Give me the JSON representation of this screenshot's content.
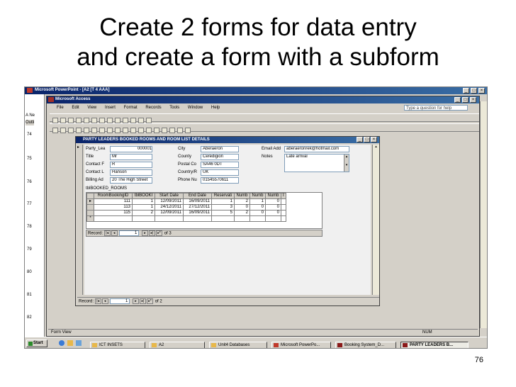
{
  "slide": {
    "title_line1": "Create 2 forms for data entry",
    "title_line2": "and create a form with a subform",
    "page_number": "76"
  },
  "powerpoint": {
    "title": "Microsoft PowerPoint - [A2 [T 4 AAA]",
    "side_tabs": [
      "A Ne",
      "Outli"
    ],
    "slide_numbers": [
      "74",
      "75",
      "76",
      "77",
      "78",
      "79",
      "80",
      "81",
      "82"
    ]
  },
  "access": {
    "title": "Microsoft Access",
    "menu": [
      "File",
      "Edit",
      "View",
      "Insert",
      "Format",
      "Records",
      "Tools",
      "Window",
      "Help"
    ],
    "help_placeholder": "Type a question for help",
    "status_left": "Form View",
    "status_right": "NUM"
  },
  "form": {
    "title": "PARTY LEADERS BOOKED ROOMS AND ROOM LIST DETAILS",
    "fields": {
      "party_lead_label": "Party_Lea",
      "party_lead_value": "000001",
      "title_label": "Title",
      "title_value": "Mr",
      "contact_f_label": "Contact F",
      "contact_f_value": "R",
      "contact_l_label": "Contact L",
      "contact_l_value": "Hanson",
      "billing_label": "Billing Ad",
      "billing_value": "20 The High Street",
      "city_label": "City",
      "city_value": "Aberaeron",
      "county_label": "County",
      "county_value": "Ceredigion",
      "postal_label": "Postal Co",
      "postal_value": "SA46 0DT",
      "country_label": "Country/R",
      "country_value": "UK",
      "phone_label": "Phone Nu",
      "phone_value": "01545570611",
      "email_label": "Email Add",
      "email_value": "aberaeronrek@hotmail.com",
      "notes_label": "Notes",
      "notes_value": "Late arrival"
    },
    "subform_label": "tblBOOKED_ROOMS",
    "subform_columns": [
      "RoomBookingID",
      "tblBOOKI",
      "Start Date",
      "End Date",
      "Reservati",
      "Numb",
      "Numb",
      "Numb",
      "I"
    ],
    "subform_rows": [
      [
        "111",
        "1",
        "12/09/2011",
        "16/09/2011",
        "1",
        "2",
        "1",
        "0"
      ],
      [
        "113",
        "1",
        "24/12/2011",
        "27/12/2011",
        "3",
        "0",
        "0",
        "0"
      ],
      [
        "115",
        "2",
        "12/09/2011",
        "16/09/2011",
        "5",
        "2",
        "0",
        "0"
      ]
    ],
    "sub_nav": {
      "label": "Record:",
      "current": "1",
      "of_text": "of 3"
    },
    "main_nav": {
      "label": "Record:",
      "current": "1",
      "of_text": "of 2"
    }
  },
  "taskbar": {
    "start": "Start",
    "items": [
      "ICT INSETS",
      "A2",
      "Unit4 Databases",
      "Microsoft PowerPo...",
      "Booking System_D...",
      "PARTY LEADERS B..."
    ]
  },
  "colors": {
    "title_bar": "#0a246a",
    "window_face": "#d4d0c8"
  }
}
